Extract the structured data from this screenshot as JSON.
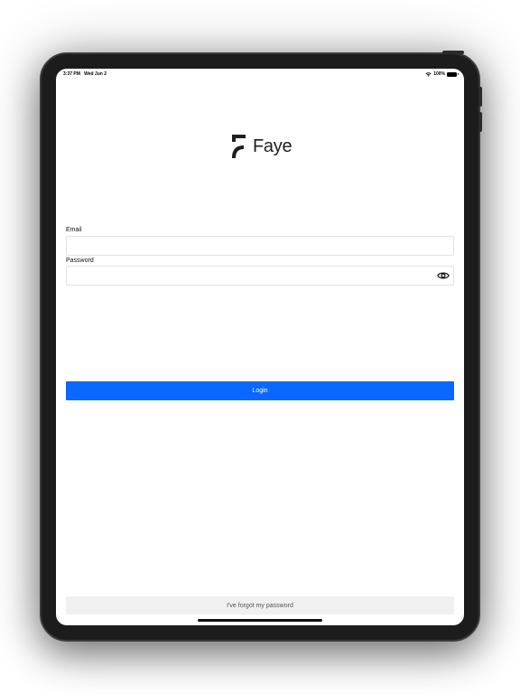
{
  "status_bar": {
    "time": "3:37 PM",
    "date": "Wed Jun 2",
    "battery": "100%"
  },
  "brand": {
    "name": "Faye",
    "logo_icon": "faye-logo-icon"
  },
  "form": {
    "email_label": "Email",
    "email_value": "",
    "email_placeholder": "",
    "password_label": "Password",
    "password_value": "",
    "password_placeholder": "",
    "password_toggle_icon": "eye-icon",
    "login_label": "Login",
    "forgot_label": "I've forgot my password"
  },
  "colors": {
    "primary": "#0a67ff",
    "secondary_button": "#f0f0f0",
    "text": "#111111"
  }
}
